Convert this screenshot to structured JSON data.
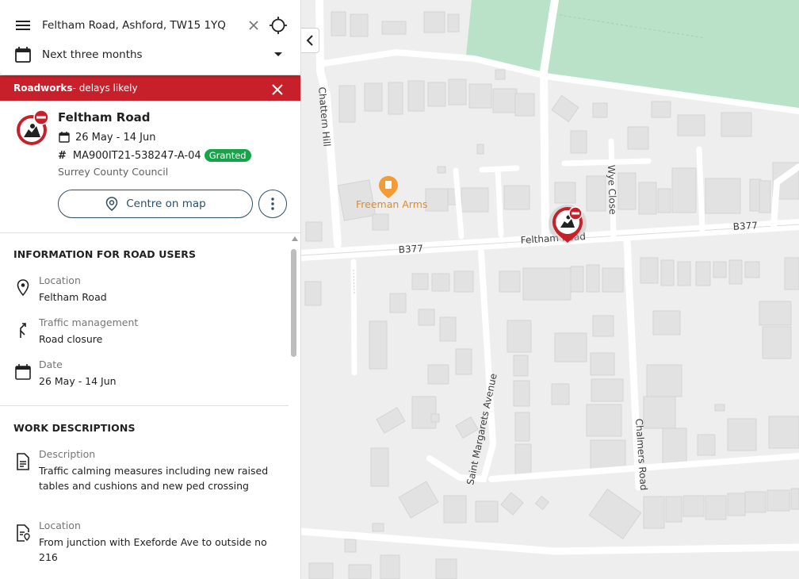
{
  "search": {
    "address": "Feltham Road, Ashford, TW15 1YQ",
    "period": "Next three months"
  },
  "alert": {
    "strong": "Roadworks",
    "text": " - delays likely"
  },
  "work": {
    "title": "Feltham Road",
    "dates": "26 May - 14 Jun",
    "reference": "MA900IT21-538247-A-04",
    "status": "Granted",
    "authority": "Surrey County Council",
    "centre_label": "Centre on map"
  },
  "road_users": {
    "heading": "INFORMATION FOR ROAD USERS",
    "items": [
      {
        "label": "Location",
        "value": "Feltham Road",
        "icon": "location-pin-icon"
      },
      {
        "label": "Traffic management",
        "value": "Road closure",
        "icon": "diversion-arrow-icon"
      },
      {
        "label": "Date",
        "value": "26 May - 14 Jun",
        "icon": "calendar-icon"
      }
    ]
  },
  "work_descriptions": {
    "heading": "WORK DESCRIPTIONS",
    "items": [
      {
        "label": "Description",
        "value": "Traffic calming measures including new raised tables and cushions and new ped crossing",
        "icon": "document-icon"
      },
      {
        "label": "Location",
        "value": "From junction with Exeforde Ave to outside no 216",
        "icon": "document-location-icon"
      }
    ]
  },
  "map": {
    "labels": {
      "chattern_hill": "Chattern Hill",
      "freeman_arms": "Freeman Arms",
      "wye_close": "Wye Close",
      "b377_left": "B377",
      "b377_right": "B377",
      "feltham_road": "Feltham Road",
      "saint_margarets": "Saint Margarets Avenue",
      "chalmers_road": "Chalmers Road"
    },
    "colors": {
      "background": "#eeeeee",
      "buildings": "#e2e2e2",
      "park": "#b9e2c8",
      "roads": "#ffffff",
      "poi": "#f29c38",
      "roadworks": "#c8202a"
    }
  }
}
